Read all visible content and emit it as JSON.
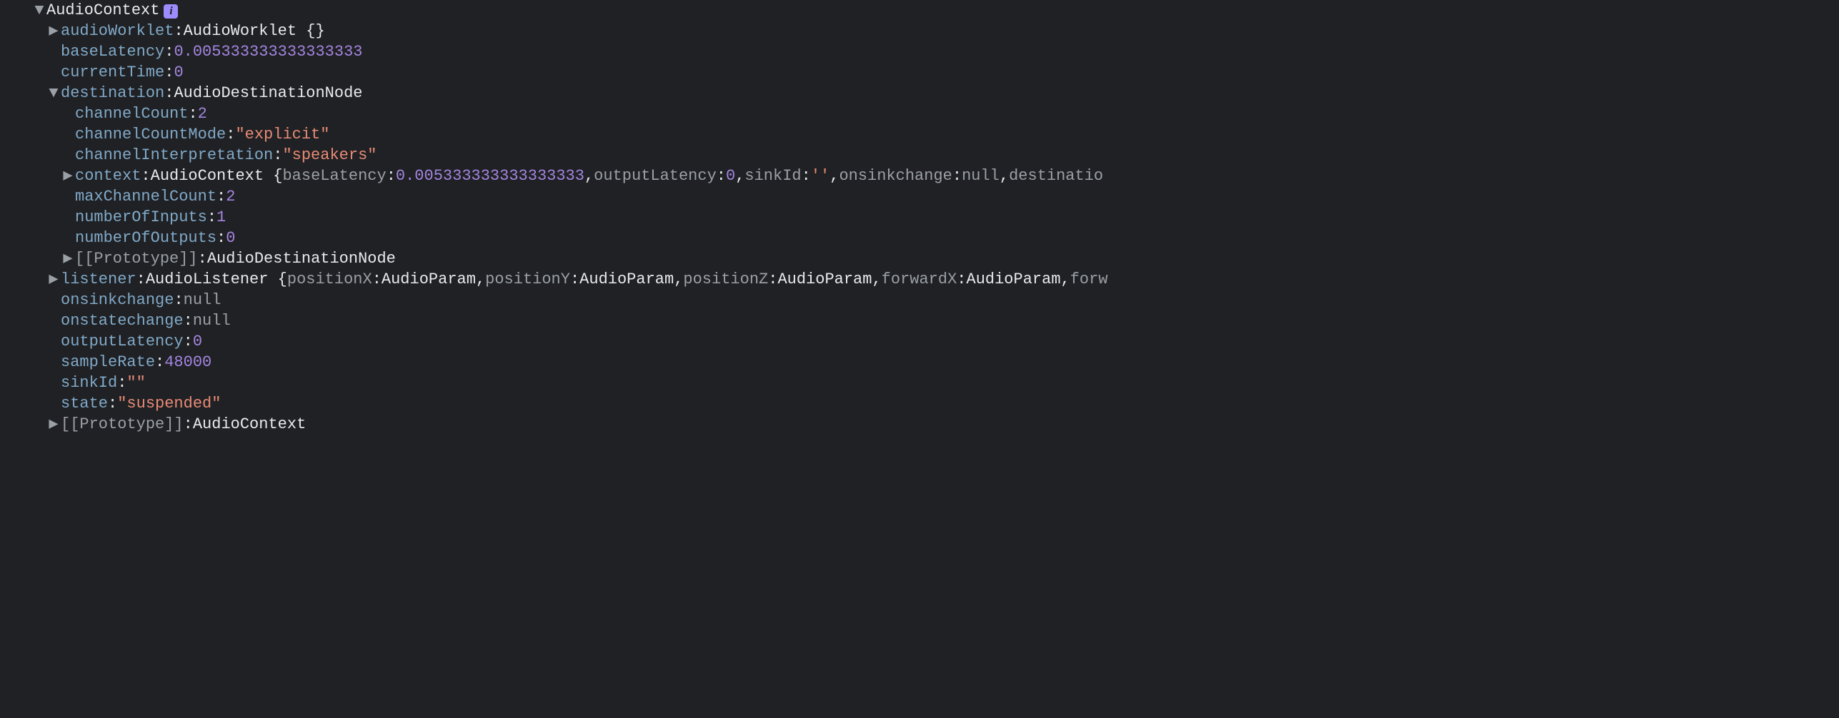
{
  "root": {
    "className": "AudioContext",
    "infoBadge": "i"
  },
  "audioWorklet": {
    "key": "audioWorklet",
    "className": "AudioWorklet",
    "braces": "{}"
  },
  "baseLatency": {
    "key": "baseLatency",
    "value": "0.005333333333333333"
  },
  "currentTime": {
    "key": "currentTime",
    "value": "0"
  },
  "destination": {
    "key": "destination",
    "className": "AudioDestinationNode",
    "channelCount": {
      "key": "channelCount",
      "value": "2"
    },
    "channelCountMode": {
      "key": "channelCountMode",
      "value": "\"explicit\""
    },
    "channelInterpretation": {
      "key": "channelInterpretation",
      "value": "\"speakers\""
    },
    "context": {
      "key": "context",
      "className": "AudioContext",
      "previewOpen": "{",
      "p1k": "baseLatency",
      "p1v": "0.005333333333333333",
      "p2k": "outputLatency",
      "p2v": "0",
      "p3k": "sinkId",
      "p3v": "''",
      "p4k": "onsinkchange",
      "p4v": "null",
      "p5k": "destinatio"
    },
    "maxChannelCount": {
      "key": "maxChannelCount",
      "value": "2"
    },
    "numberOfInputs": {
      "key": "numberOfInputs",
      "value": "1"
    },
    "numberOfOutputs": {
      "key": "numberOfOutputs",
      "value": "0"
    },
    "proto": {
      "key": "[[Prototype]]",
      "className": "AudioDestinationNode"
    }
  },
  "listener": {
    "key": "listener",
    "className": "AudioListener",
    "previewOpen": "{",
    "p1k": "positionX",
    "p1v": "AudioParam",
    "p2k": "positionY",
    "p2v": "AudioParam",
    "p3k": "positionZ",
    "p3v": "AudioParam",
    "p4k": "forwardX",
    "p4v": "AudioParam",
    "p5k": "forw"
  },
  "onsinkchange": {
    "key": "onsinkchange",
    "value": "null"
  },
  "onstatechange": {
    "key": "onstatechange",
    "value": "null"
  },
  "outputLatency": {
    "key": "outputLatency",
    "value": "0"
  },
  "sampleRate": {
    "key": "sampleRate",
    "value": "48000"
  },
  "sinkId": {
    "key": "sinkId",
    "value": "\"\""
  },
  "state": {
    "key": "state",
    "value": "\"suspended\""
  },
  "proto": {
    "key": "[[Prototype]]",
    "className": "AudioContext"
  }
}
